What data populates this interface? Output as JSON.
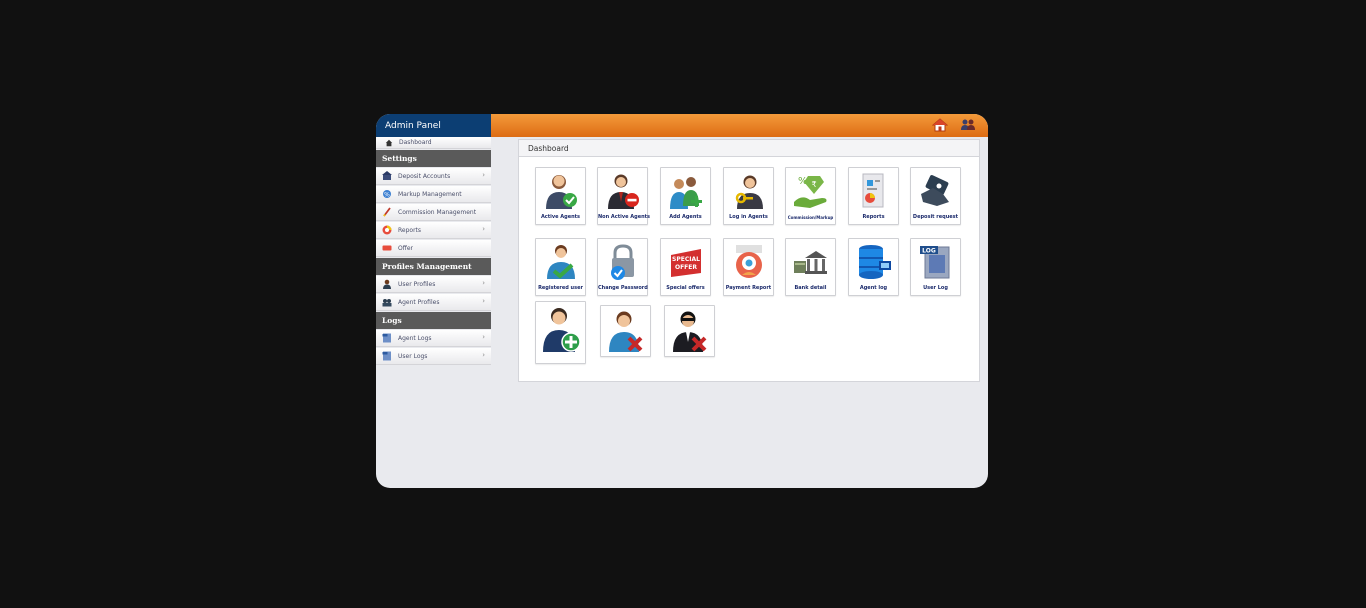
{
  "header": {
    "title": "Admin Panel",
    "icons": [
      "home-icon",
      "users-icon"
    ]
  },
  "sidebar": {
    "dashboard": "Dashboard",
    "sections": [
      {
        "title": "Settings",
        "items": [
          "Deposit Accounts",
          "Markup Management",
          "Commission Management",
          "Reports",
          "Offer"
        ]
      },
      {
        "title": "Profiles Management",
        "items": [
          "User Profiles",
          "Agent Profiles"
        ]
      },
      {
        "title": "Logs",
        "items": [
          "Agent Logs",
          "User Logs"
        ]
      }
    ]
  },
  "main": {
    "title": "Dashboard",
    "tiles": [
      "Active Agents",
      "Non Active Agents",
      "Add Agents",
      "Log in Agents",
      "Commission/Markup",
      "Reports",
      "Deposit request",
      "Registered user",
      "Change Password",
      "Special offers",
      "Payment Report",
      "Bank detail",
      "Agent log",
      "User Log"
    ],
    "icon_tiles": [
      "add-user-icon",
      "remove-user-icon",
      "remove-agent-icon"
    ]
  },
  "colors": {
    "brand": "#0c3e73",
    "accent": "#e57820",
    "section": "#5a5a5a",
    "tile_label": "#1b2a6b"
  }
}
